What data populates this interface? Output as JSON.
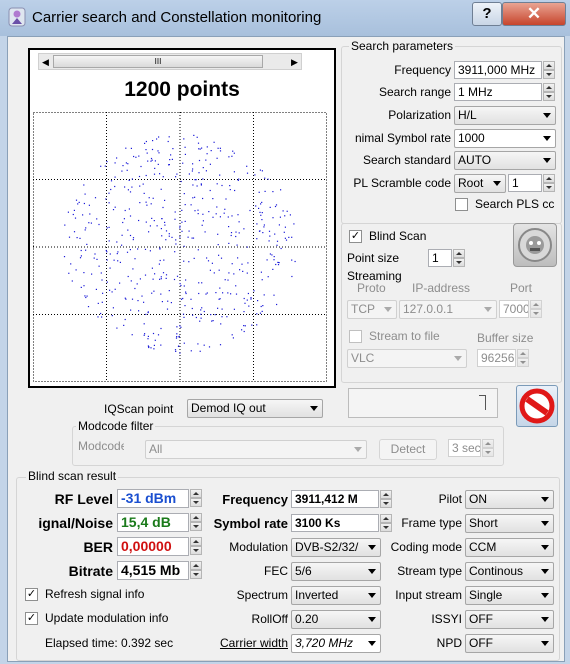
{
  "window": {
    "title": "Carrier search and Constellation monitoring",
    "help_label": "?",
    "close_label": "✕"
  },
  "constellation": {
    "points_label": "1200 points",
    "scroll_thumb": "III",
    "point_color": "#1a1ad8"
  },
  "search_params": {
    "title": "Search parameters",
    "frequency_label": "Frequency",
    "frequency_value": "3911,000 MHz",
    "search_range_label": "Search range",
    "search_range_value": "1 MHz",
    "polarization_label": "Polarization",
    "polarization_value": "H/L",
    "symbol_rate_label": "nimal Symbol rate",
    "symbol_rate_value": "1000",
    "search_standard_label": "Search standard",
    "search_standard_value": "AUTO",
    "pl_scramble_label": "PL Scramble code",
    "pl_scramble_mode": "Root",
    "pl_scramble_value": "1",
    "search_pls_label": "Search PLS cc"
  },
  "blind_scan": {
    "label": "Blind Scan",
    "checked": true,
    "point_size_label": "Point size",
    "point_size_value": "1"
  },
  "streaming": {
    "title": "Streaming",
    "proto_label": "Proto",
    "ip_label": "IP-address",
    "port_label": "Port",
    "proto_value": "TCP",
    "ip_value": "127.0.0.1",
    "port_value": "7000",
    "stream_to_file_label": "Stream to file",
    "buffer_size_label": "Buffer size",
    "player_value": "VLC",
    "buffer_value": "96256"
  },
  "iqscan": {
    "label": "IQScan point",
    "value": "Demod IQ out"
  },
  "modcode": {
    "title": "Modcode filter",
    "label": "Modcode",
    "value": "All",
    "detect_label": "Detect",
    "time_value": "3 sec"
  },
  "result": {
    "title": "Blind scan result",
    "rf_level_label": "RF Level",
    "rf_level_value": "-31 dBm",
    "snr_label": "ignal/Noise",
    "snr_value": "15,4 dB",
    "ber_label": "BER",
    "ber_value": "0,00000",
    "bitrate_label": "Bitrate",
    "bitrate_value": "4,515 Mb",
    "frequency_label": "Frequency",
    "frequency_value": "3911,412 M",
    "symbol_rate_label": "Symbol rate",
    "symbol_rate_value": "3100 Ks",
    "modulation_label": "Modulation",
    "modulation_value": "DVB-S2/32/",
    "fec_label": "FEC",
    "fec_value": "5/6",
    "spectrum_label": "Spectrum",
    "spectrum_value": "Inverted",
    "rolloff_label": "RollOff",
    "rolloff_value": "0.20",
    "carrier_width_label": "Carrier width",
    "carrier_width_value": "3,720 MHz",
    "pilot_label": "Pilot",
    "pilot_value": "ON",
    "frame_type_label": "Frame type",
    "frame_type_value": "Short",
    "coding_mode_label": "Coding mode",
    "coding_mode_value": "CCM",
    "stream_type_label": "Stream type",
    "stream_type_value": "Continous",
    "input_stream_label": "Input stream",
    "input_stream_value": "Single",
    "issyi_label": "ISSYI",
    "issyi_value": "OFF",
    "npd_label": "NPD",
    "npd_value": "OFF",
    "refresh_label": "Refresh signal info",
    "update_mod_label": "Update modulation info",
    "elapsed_label": "Elapsed time: 0.392 sec",
    "colors": {
      "rf_level": "#1a4fd0",
      "snr": "#1a7a1a",
      "ber": "#d01010"
    }
  }
}
